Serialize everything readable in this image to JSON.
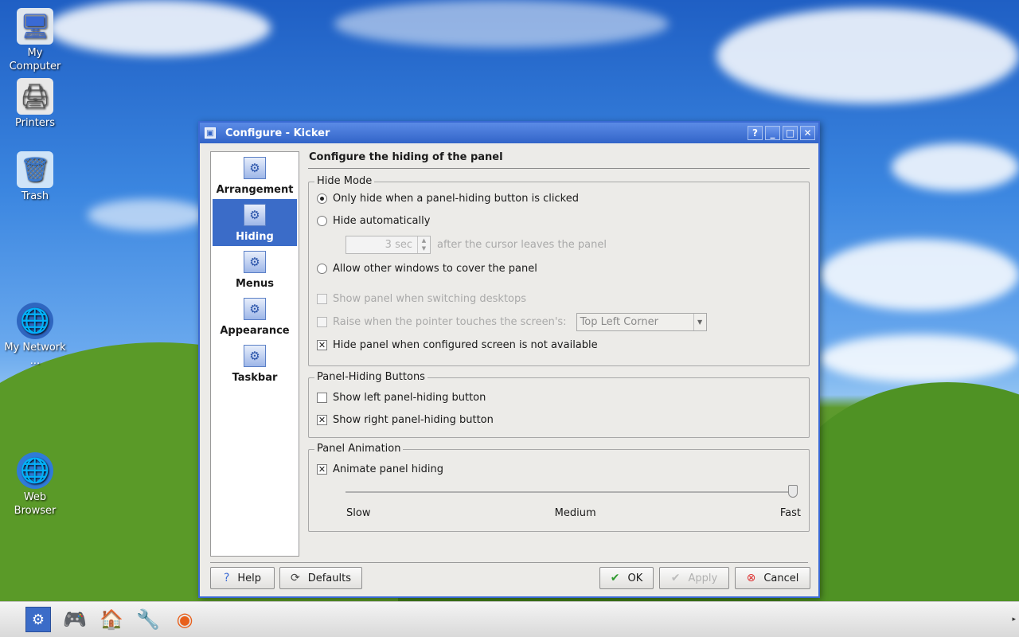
{
  "desktop": {
    "icons": [
      {
        "label": "My Computer",
        "icon": "computer-icon"
      },
      {
        "label": "Printers",
        "icon": "printer-icon"
      },
      {
        "label": "Trash",
        "icon": "trash-icon"
      },
      {
        "label": "My Network ...",
        "icon": "network-globe-icon"
      },
      {
        "label": "Web Browser",
        "icon": "web-browser-icon"
      }
    ]
  },
  "window": {
    "title": "Configure - Kicker",
    "buttons": {
      "help": "?",
      "minimize": "_",
      "maximize": "□",
      "close": "✕"
    }
  },
  "sidebar": {
    "items": [
      {
        "label": "Arrangement",
        "active": false
      },
      {
        "label": "Hiding",
        "active": true
      },
      {
        "label": "Menus",
        "active": false
      },
      {
        "label": "Appearance",
        "active": false
      },
      {
        "label": "Taskbar",
        "active": false
      }
    ]
  },
  "page": {
    "title": "Configure the hiding of the panel",
    "hide_mode": {
      "legend": "Hide Mode",
      "option_only_hide": "Only hide when a panel-hiding button is clicked",
      "option_hide_auto": "Hide automatically",
      "delay_value": "3 sec",
      "delay_suffix": "after the cursor leaves the panel",
      "option_allow_cover": "Allow other windows to cover the panel",
      "show_when_switching": "Show panel when switching desktops",
      "raise_when_pointer": "Raise when the pointer touches the screen's:",
      "corner_value": "Top Left Corner",
      "hide_when_unavailable": "Hide panel when configured screen is not available",
      "selected": "only_hide"
    },
    "hiding_buttons": {
      "legend": "Panel-Hiding Buttons",
      "show_left": "Show left panel-hiding button",
      "show_right": "Show right panel-hiding button",
      "show_left_checked": false,
      "show_right_checked": true
    },
    "animation": {
      "legend": "Panel Animation",
      "animate": "Animate panel hiding",
      "animate_checked": true,
      "speed_level": 1.0,
      "label_slow": "Slow",
      "label_medium": "Medium",
      "label_fast": "Fast"
    }
  },
  "footer": {
    "help": "Help",
    "defaults": "Defaults",
    "ok": "OK",
    "apply": "Apply",
    "cancel": "Cancel"
  },
  "taskbar": {
    "items": [
      "kmenu-icon",
      "games-icon",
      "home-icon",
      "settings-wrench-icon",
      "firefox-icon"
    ],
    "arrow": "▸"
  }
}
